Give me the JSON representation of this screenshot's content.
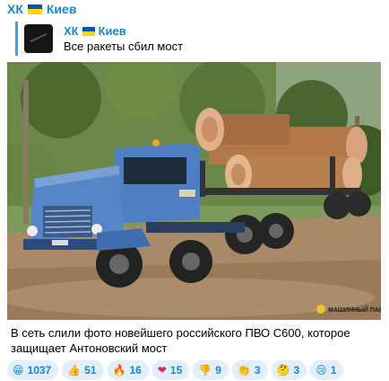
{
  "channel": {
    "name": "ХК",
    "name_suffix": "Киев"
  },
  "reply": {
    "title": "ХК",
    "title_suffix": "Киев",
    "text": "Все ракеты сбил мост"
  },
  "photo": {
    "watermark": "МАШИННЫЙ ПАРК"
  },
  "caption": "В сеть слили фото новейшего российского ПВО С600, которое защищает Антоновский мост",
  "reactions": [
    {
      "emoji": "😁",
      "count": "1037"
    },
    {
      "emoji": "👍",
      "count": "51"
    },
    {
      "emoji": "🔥",
      "count": "16"
    },
    {
      "emoji": "❤",
      "count": "15"
    },
    {
      "emoji": "👎",
      "count": "9"
    },
    {
      "emoji": "👏",
      "count": "3"
    },
    {
      "emoji": "🤔",
      "count": "3"
    },
    {
      "emoji": "😢",
      "count": "1"
    }
  ],
  "colors": {
    "accent": "#168acd",
    "reaction_bg": "#e2eef9",
    "truck_blue": "#4f7fc2",
    "flag_blue": "#0057b7",
    "flag_yellow": "#ffd700"
  },
  "icons": {
    "flag": "ukraine-flag-icon",
    "avatar": "channel-avatar"
  }
}
